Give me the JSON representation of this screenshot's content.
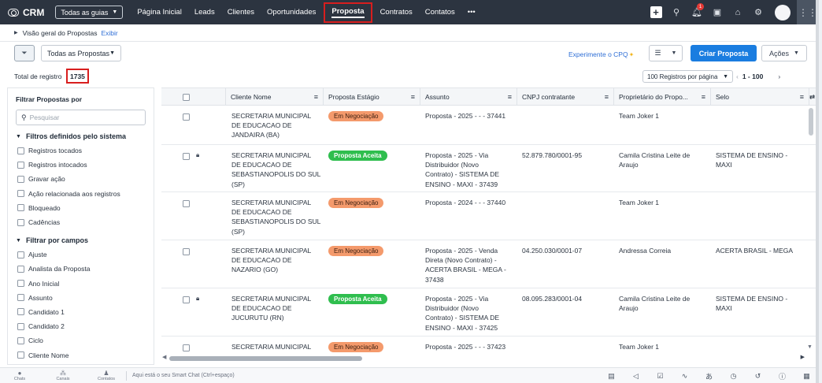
{
  "app": {
    "name": "CRM"
  },
  "nav": {
    "guides_label": "Todas as guias",
    "items": [
      "Página Inicial",
      "Leads",
      "Clientes",
      "Oportunidades",
      "Proposta",
      "Contratos",
      "Contatos"
    ],
    "active_index": 4,
    "more": "•••",
    "notification_count": "1"
  },
  "breadcrumb": {
    "title": "Visão geral do Propostas",
    "action": "Exibir"
  },
  "toolbar": {
    "view_select": "Todas as Propostas",
    "cpq_link": "Experimente o CPQ",
    "create_button": "Criar Proposta",
    "actions_button": "Ações"
  },
  "count": {
    "label": "Total de registro",
    "value": "1735",
    "per_page": "100 Registros por página",
    "range": "1 - 100"
  },
  "sidebar": {
    "title": "Filtrar Propostas por",
    "search_placeholder": "Pesquisar",
    "section_system": "Filtros definidos pelo sistema",
    "system_filters": [
      "Registros tocados",
      "Registros intocados",
      "Gravar ação",
      "Ação relacionada aos registros",
      "Bloqueado",
      "Cadências"
    ],
    "section_fields": "Filtrar por campos",
    "field_filters": [
      "Ajuste",
      "Analista da Proposta",
      "Ano Inicial",
      "Assunto",
      "Candidato 1",
      "Candidato 2",
      "Ciclo",
      "Cliente Nome"
    ]
  },
  "table": {
    "columns": [
      "Cliente Nome",
      "Proposta Estágio",
      "Assunto",
      "CNPJ contratante",
      "Proprietário do Propo...",
      "Selo"
    ],
    "rows": [
      {
        "locked": false,
        "cliente": [
          "SECRETARIA MUNICIPAL",
          "DE EDUCACAO DE",
          "JANDAIRA (BA)"
        ],
        "estagio": "Em Negociação",
        "estagio_type": "neg",
        "assunto": [
          "Proposta - 2025 - - - 37441"
        ],
        "cnpj": "",
        "proprietario": [
          "Team Joker 1"
        ],
        "selo": []
      },
      {
        "locked": true,
        "cliente": [
          "SECRETARIA MUNICIPAL",
          "DE EDUCACAO DE",
          "SEBASTIANOPOLIS DO SUL",
          "(SP)"
        ],
        "estagio": "Proposta Aceita",
        "estagio_type": "ok",
        "assunto": [
          "Proposta - 2025 - Via",
          "Distribuidor (Novo",
          "Contrato) - SISTEMA DE",
          "ENSINO - MAXI - 37439"
        ],
        "cnpj": "52.879.780/0001-95",
        "proprietario": [
          "Camila Cristina Leite de",
          "Araujo"
        ],
        "selo": [
          "SISTEMA DE ENSINO -",
          "MAXI"
        ]
      },
      {
        "locked": false,
        "cliente": [
          "SECRETARIA MUNICIPAL",
          "DE EDUCACAO DE",
          "SEBASTIANOPOLIS DO SUL",
          "(SP)"
        ],
        "estagio": "Em Negociação",
        "estagio_type": "neg",
        "assunto": [
          "Proposta - 2024 - - - 37440"
        ],
        "cnpj": "",
        "proprietario": [
          "Team Joker 1"
        ],
        "selo": []
      },
      {
        "locked": false,
        "cliente": [
          "SECRETARIA MUNICIPAL",
          "DE EDUCACAO DE",
          "NAZARIO (GO)"
        ],
        "estagio": "Em Negociação",
        "estagio_type": "neg",
        "assunto": [
          "Proposta - 2025 - Venda",
          "Direta (Novo Contrato) -",
          "ACERTA BRASIL - MEGA -",
          "37438"
        ],
        "cnpj": "04.250.030/0001-07",
        "proprietario": [
          "Andressa Correia"
        ],
        "selo": [
          "ACERTA BRASIL - MEGA"
        ]
      },
      {
        "locked": true,
        "cliente": [
          "SECRETARIA MUNICIPAL",
          "DE EDUCACAO DE",
          "JUCURUTU (RN)"
        ],
        "estagio": "Proposta Aceita",
        "estagio_type": "ok",
        "assunto": [
          "Proposta - 2025 - Via",
          "Distribuidor (Novo",
          "Contrato) - SISTEMA DE",
          "ENSINO - MAXI - 37425"
        ],
        "cnpj": "08.095.283/0001-04",
        "proprietario": [
          "Camila Cristina Leite de",
          "Araujo"
        ],
        "selo": [
          "SISTEMA DE ENSINO -",
          "MAXI"
        ]
      },
      {
        "locked": false,
        "cliente": [
          "SECRETARIA MUNICIPAL"
        ],
        "estagio": "Em Negociação",
        "estagio_type": "neg",
        "assunto": [
          "Proposta - 2025 - - - 37423"
        ],
        "cnpj": "",
        "proprietario": [
          "Team Joker 1"
        ],
        "selo": []
      }
    ]
  },
  "bottombar": {
    "items": [
      "Chats",
      "Canais",
      "Contatos"
    ],
    "smart_chat": "Aqui está o seu Smart Chat (Ctrl+espaço)"
  },
  "icons": {
    "logo": "crm-logo-icon",
    "filter": "funnel-icon",
    "search": "magnifier-icon",
    "lock": "lock-icon"
  },
  "colors": {
    "nav_bg": "#2c3440",
    "primary": "#1a7de0",
    "highlight": "#d81e1e",
    "pill_negotiation": "#f49a6c",
    "pill_accepted": "#2fbe4e"
  }
}
